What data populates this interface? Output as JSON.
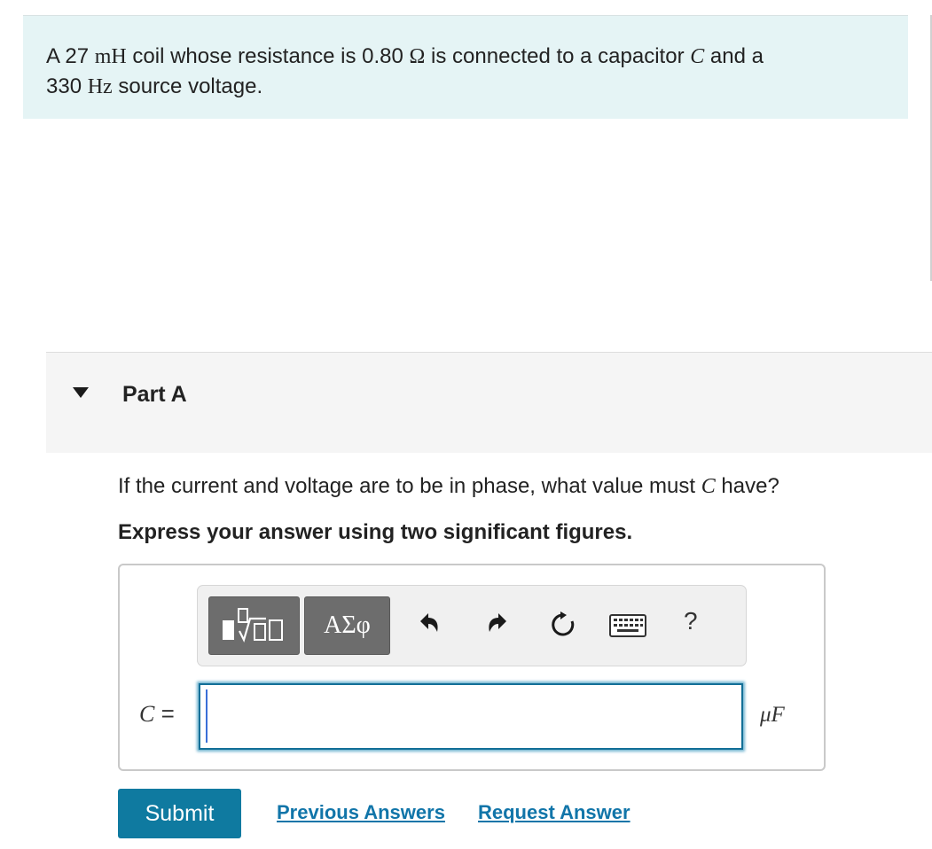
{
  "problem": {
    "parts": [
      {
        "t": "text",
        "v": "A 27 "
      },
      {
        "t": "math",
        "v": "mH"
      },
      {
        "t": "text",
        "v": " coil whose resistance is 0.80 "
      },
      {
        "t": "math",
        "v": "Ω"
      },
      {
        "t": "text",
        "v": " is connected to a capacitor "
      },
      {
        "t": "mathit",
        "v": "C"
      },
      {
        "t": "text",
        "v": " and a "
      },
      {
        "t": "text",
        "v": "330 "
      },
      {
        "t": "math",
        "v": "Hz"
      },
      {
        "t": "text",
        "v": " source voltage."
      }
    ]
  },
  "part": {
    "title": "Part A",
    "question_before": "If the current and voltage are to be in phase, what value must ",
    "question_var": "C",
    "question_after": " have?",
    "instruction": "Express your answer using two significant figures."
  },
  "toolbar": {
    "symbols_label": "ΑΣφ",
    "help_label": "?"
  },
  "answer": {
    "var_label": "C",
    "equals": "=",
    "value": "",
    "unit": "μF"
  },
  "actions": {
    "submit_label": "Submit",
    "previous_answers_label": "Previous Answers",
    "request_answer_label": "Request Answer"
  },
  "colors": {
    "problem_bg": "#e5f4f5",
    "submit_bg": "#0f7aa0",
    "link": "#1175a9",
    "input_border": "#136f97"
  }
}
